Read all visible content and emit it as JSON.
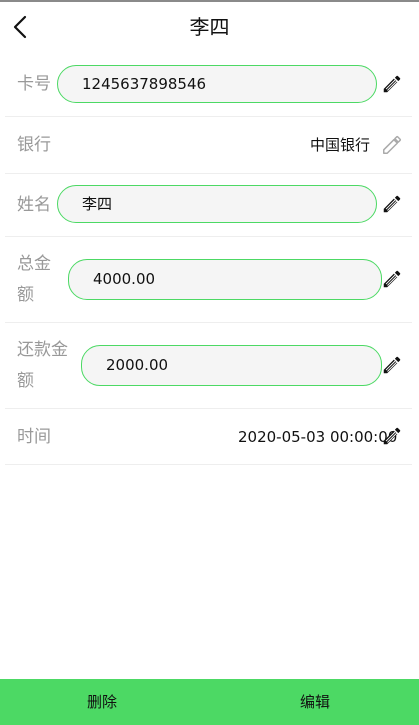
{
  "header": {
    "title": "李四"
  },
  "fields": {
    "card": {
      "label": "卡号",
      "value": "1245637898546"
    },
    "bank": {
      "label": "银行",
      "value": "中国银行"
    },
    "name": {
      "label": "姓名",
      "value": "李四"
    },
    "total": {
      "label_line1": "总金",
      "label_line2": "额",
      "value": "4000.00"
    },
    "repaid": {
      "label_line1": "还款金",
      "label_line2": "额",
      "value": "2000.00"
    },
    "time": {
      "label": "时间",
      "value": "2020-05-03 00:00:00"
    }
  },
  "icons": {
    "back": "chevron-left-icon",
    "edit": "pencil-icon"
  },
  "colors": {
    "accent": "#4cd964",
    "field_bg": "#f5f5f5",
    "label": "#999999",
    "edit_disabled": "#aaaaaa"
  },
  "bottom_bar": {
    "delete_label": "删除",
    "edit_label": "编辑"
  }
}
